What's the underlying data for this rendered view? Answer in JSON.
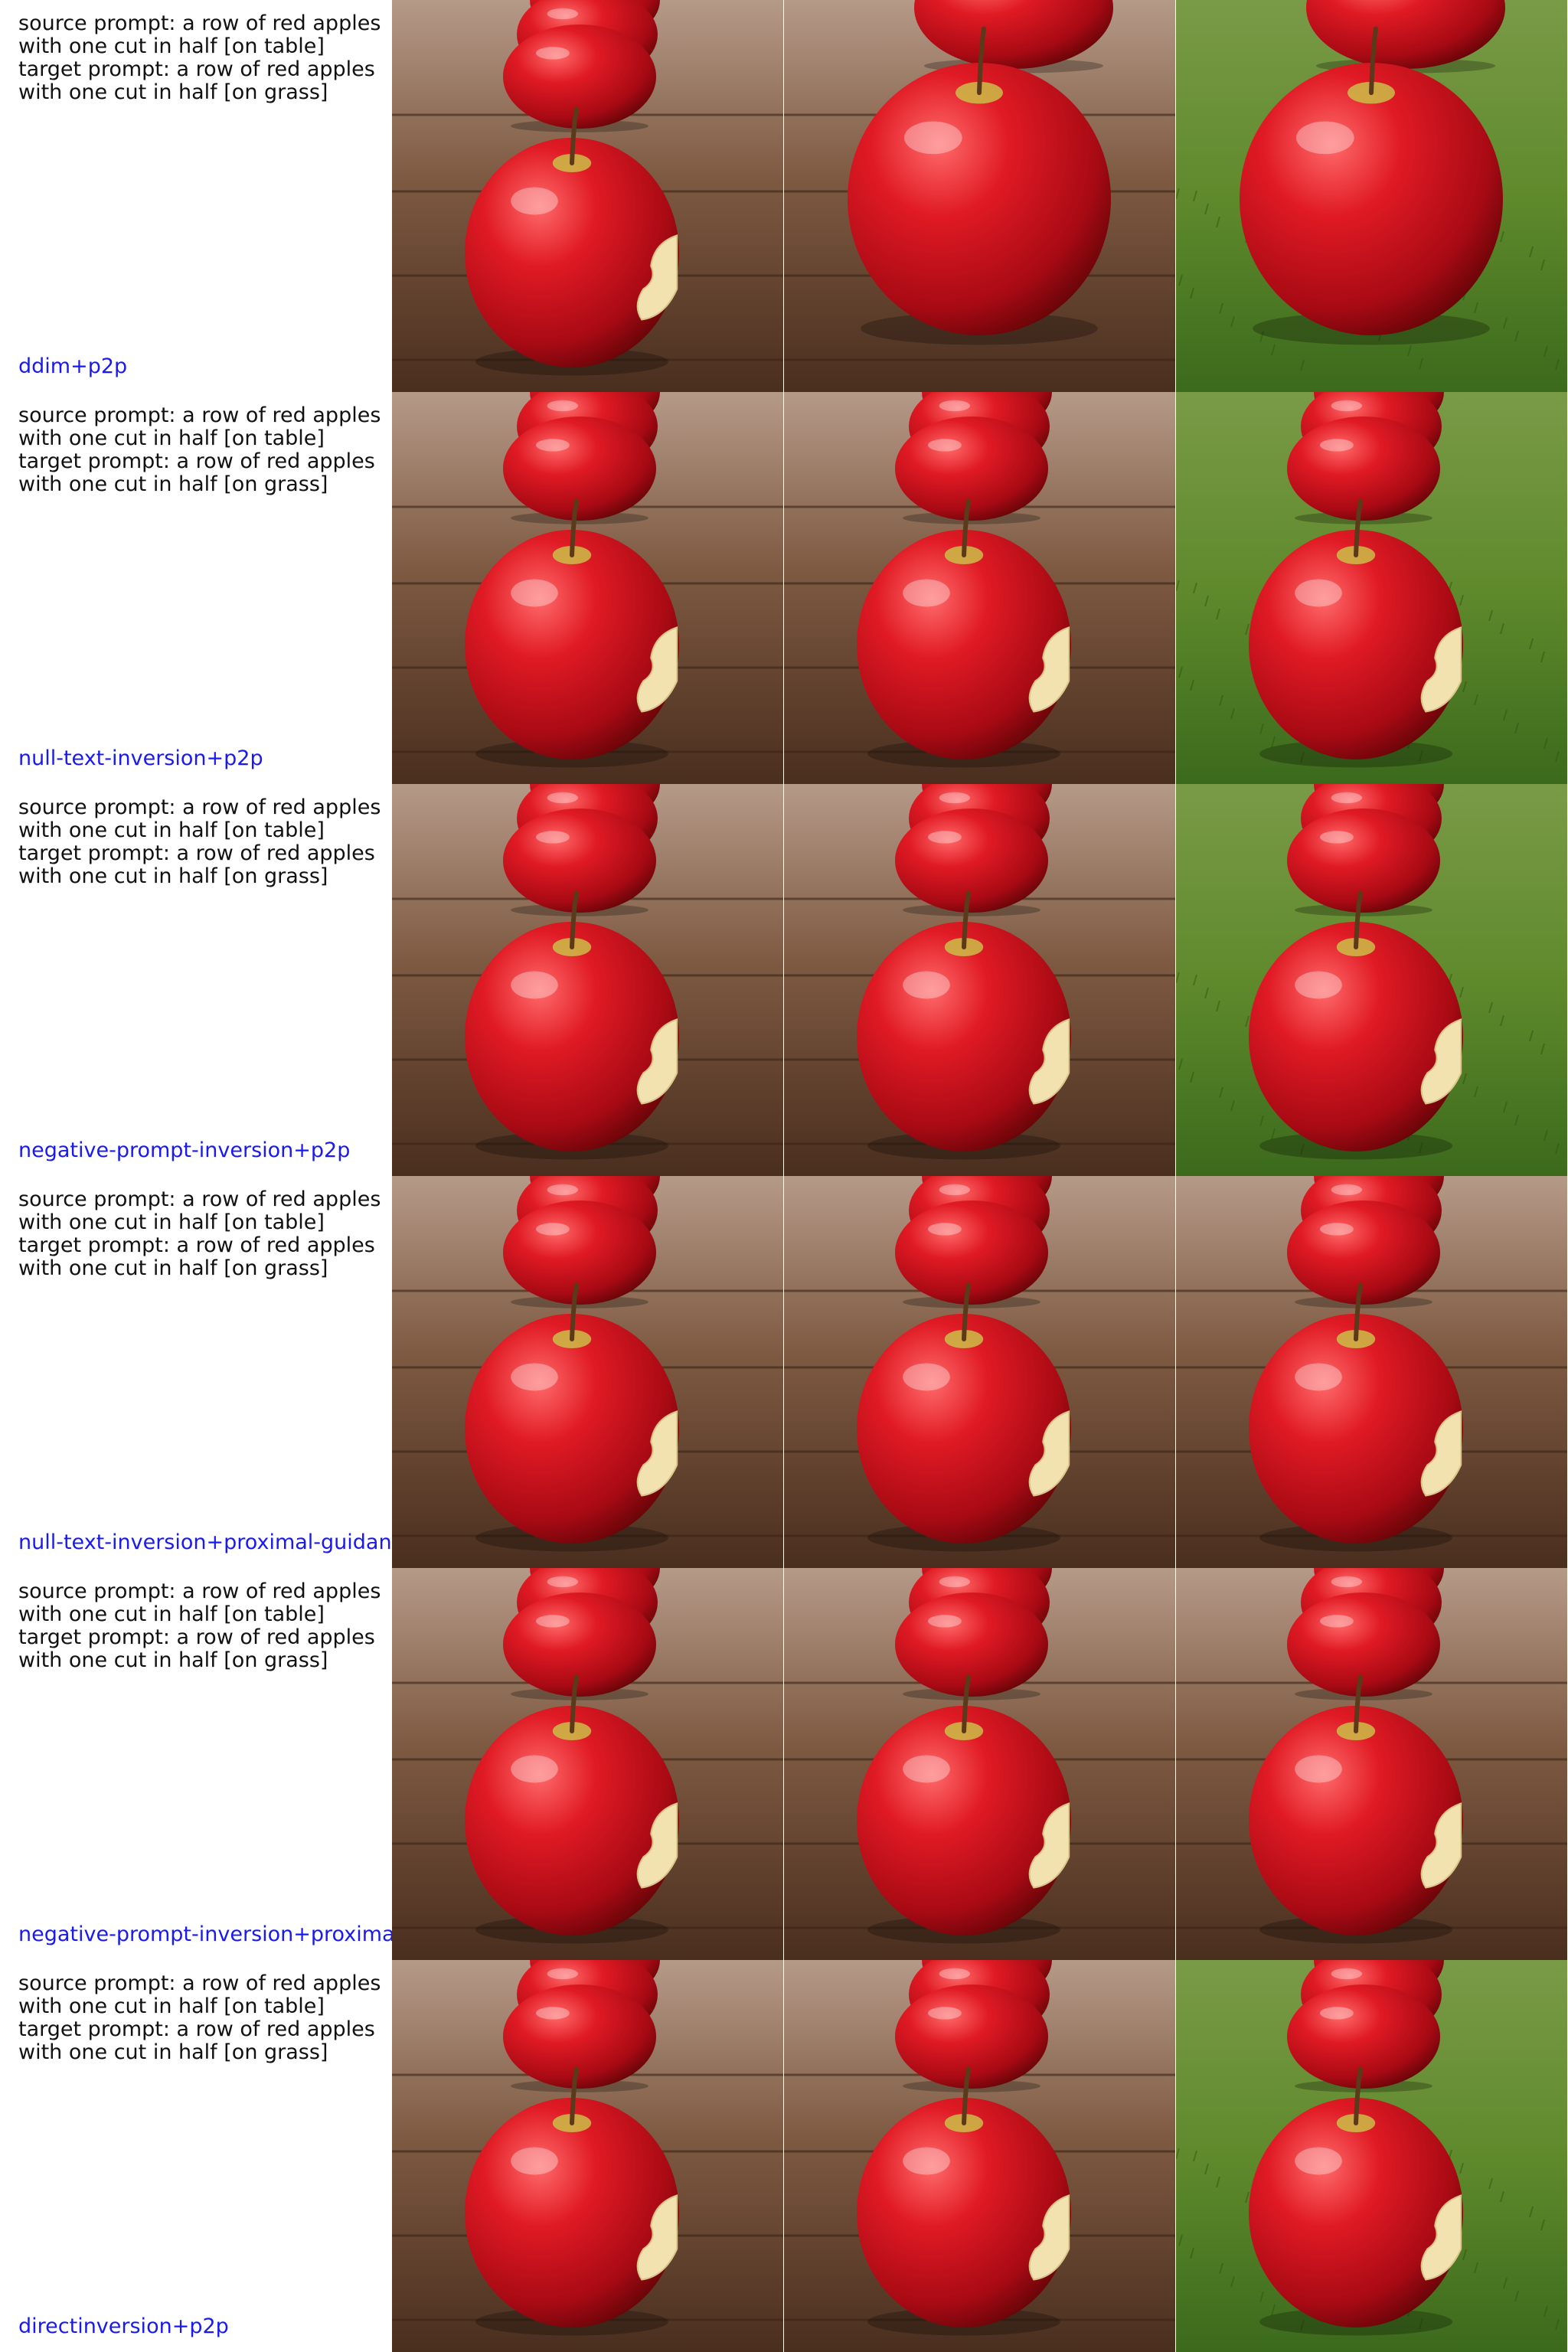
{
  "source_prompt_line1": "source prompt: a row of red apples",
  "source_prompt_line2": "with one cut in half [on table]",
  "target_prompt_line1": "target prompt: a row of red apples",
  "target_prompt_line2": "with one cut in half [on grass]",
  "colors": {
    "method_label": "#1a1aee",
    "table": "#6b4a33",
    "grass": "#5f8a2c",
    "apple": "#c8101e"
  },
  "rows": [
    {
      "method": "ddim+p2p",
      "images": [
        {
          "scene": "row",
          "background": "table"
        },
        {
          "scene": "closeup",
          "background": "table"
        },
        {
          "scene": "closeup",
          "background": "grass"
        }
      ]
    },
    {
      "method": "null-text-inversion+p2p",
      "images": [
        {
          "scene": "row",
          "background": "table"
        },
        {
          "scene": "row",
          "background": "table"
        },
        {
          "scene": "row",
          "background": "grass"
        }
      ]
    },
    {
      "method": "negative-prompt-inversion+p2p",
      "images": [
        {
          "scene": "row",
          "background": "table"
        },
        {
          "scene": "row",
          "background": "table"
        },
        {
          "scene": "row",
          "background": "grass"
        }
      ]
    },
    {
      "method": "null-text-inversion+proximal-guidance",
      "images": [
        {
          "scene": "row",
          "background": "table"
        },
        {
          "scene": "row",
          "background": "table"
        },
        {
          "scene": "row",
          "background": "table"
        }
      ]
    },
    {
      "method": "negative-prompt-inversion+proximal-g",
      "images": [
        {
          "scene": "row",
          "background": "table"
        },
        {
          "scene": "row",
          "background": "table"
        },
        {
          "scene": "row",
          "background": "table"
        }
      ]
    },
    {
      "method": "directinversion+p2p",
      "images": [
        {
          "scene": "row",
          "background": "table"
        },
        {
          "scene": "row",
          "background": "table"
        },
        {
          "scene": "row",
          "background": "grass"
        }
      ]
    }
  ]
}
